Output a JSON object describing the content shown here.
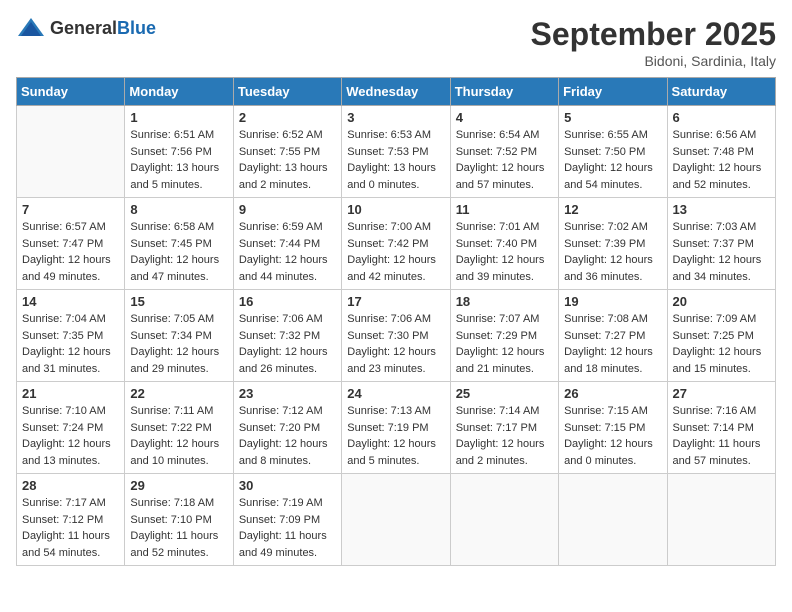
{
  "logo": {
    "general": "General",
    "blue": "Blue"
  },
  "title": "September 2025",
  "location": "Bidoni, Sardinia, Italy",
  "days_of_week": [
    "Sunday",
    "Monday",
    "Tuesday",
    "Wednesday",
    "Thursday",
    "Friday",
    "Saturday"
  ],
  "weeks": [
    [
      {
        "day": "",
        "sunrise": "",
        "sunset": "",
        "daylight": "",
        "empty": true
      },
      {
        "day": "1",
        "sunrise": "Sunrise: 6:51 AM",
        "sunset": "Sunset: 7:56 PM",
        "daylight": "Daylight: 13 hours and 5 minutes.",
        "empty": false
      },
      {
        "day": "2",
        "sunrise": "Sunrise: 6:52 AM",
        "sunset": "Sunset: 7:55 PM",
        "daylight": "Daylight: 13 hours and 2 minutes.",
        "empty": false
      },
      {
        "day": "3",
        "sunrise": "Sunrise: 6:53 AM",
        "sunset": "Sunset: 7:53 PM",
        "daylight": "Daylight: 13 hours and 0 minutes.",
        "empty": false
      },
      {
        "day": "4",
        "sunrise": "Sunrise: 6:54 AM",
        "sunset": "Sunset: 7:52 PM",
        "daylight": "Daylight: 12 hours and 57 minutes.",
        "empty": false
      },
      {
        "day": "5",
        "sunrise": "Sunrise: 6:55 AM",
        "sunset": "Sunset: 7:50 PM",
        "daylight": "Daylight: 12 hours and 54 minutes.",
        "empty": false
      },
      {
        "day": "6",
        "sunrise": "Sunrise: 6:56 AM",
        "sunset": "Sunset: 7:48 PM",
        "daylight": "Daylight: 12 hours and 52 minutes.",
        "empty": false
      }
    ],
    [
      {
        "day": "7",
        "sunrise": "Sunrise: 6:57 AM",
        "sunset": "Sunset: 7:47 PM",
        "daylight": "Daylight: 12 hours and 49 minutes.",
        "empty": false
      },
      {
        "day": "8",
        "sunrise": "Sunrise: 6:58 AM",
        "sunset": "Sunset: 7:45 PM",
        "daylight": "Daylight: 12 hours and 47 minutes.",
        "empty": false
      },
      {
        "day": "9",
        "sunrise": "Sunrise: 6:59 AM",
        "sunset": "Sunset: 7:44 PM",
        "daylight": "Daylight: 12 hours and 44 minutes.",
        "empty": false
      },
      {
        "day": "10",
        "sunrise": "Sunrise: 7:00 AM",
        "sunset": "Sunset: 7:42 PM",
        "daylight": "Daylight: 12 hours and 42 minutes.",
        "empty": false
      },
      {
        "day": "11",
        "sunrise": "Sunrise: 7:01 AM",
        "sunset": "Sunset: 7:40 PM",
        "daylight": "Daylight: 12 hours and 39 minutes.",
        "empty": false
      },
      {
        "day": "12",
        "sunrise": "Sunrise: 7:02 AM",
        "sunset": "Sunset: 7:39 PM",
        "daylight": "Daylight: 12 hours and 36 minutes.",
        "empty": false
      },
      {
        "day": "13",
        "sunrise": "Sunrise: 7:03 AM",
        "sunset": "Sunset: 7:37 PM",
        "daylight": "Daylight: 12 hours and 34 minutes.",
        "empty": false
      }
    ],
    [
      {
        "day": "14",
        "sunrise": "Sunrise: 7:04 AM",
        "sunset": "Sunset: 7:35 PM",
        "daylight": "Daylight: 12 hours and 31 minutes.",
        "empty": false
      },
      {
        "day": "15",
        "sunrise": "Sunrise: 7:05 AM",
        "sunset": "Sunset: 7:34 PM",
        "daylight": "Daylight: 12 hours and 29 minutes.",
        "empty": false
      },
      {
        "day": "16",
        "sunrise": "Sunrise: 7:06 AM",
        "sunset": "Sunset: 7:32 PM",
        "daylight": "Daylight: 12 hours and 26 minutes.",
        "empty": false
      },
      {
        "day": "17",
        "sunrise": "Sunrise: 7:06 AM",
        "sunset": "Sunset: 7:30 PM",
        "daylight": "Daylight: 12 hours and 23 minutes.",
        "empty": false
      },
      {
        "day": "18",
        "sunrise": "Sunrise: 7:07 AM",
        "sunset": "Sunset: 7:29 PM",
        "daylight": "Daylight: 12 hours and 21 minutes.",
        "empty": false
      },
      {
        "day": "19",
        "sunrise": "Sunrise: 7:08 AM",
        "sunset": "Sunset: 7:27 PM",
        "daylight": "Daylight: 12 hours and 18 minutes.",
        "empty": false
      },
      {
        "day": "20",
        "sunrise": "Sunrise: 7:09 AM",
        "sunset": "Sunset: 7:25 PM",
        "daylight": "Daylight: 12 hours and 15 minutes.",
        "empty": false
      }
    ],
    [
      {
        "day": "21",
        "sunrise": "Sunrise: 7:10 AM",
        "sunset": "Sunset: 7:24 PM",
        "daylight": "Daylight: 12 hours and 13 minutes.",
        "empty": false
      },
      {
        "day": "22",
        "sunrise": "Sunrise: 7:11 AM",
        "sunset": "Sunset: 7:22 PM",
        "daylight": "Daylight: 12 hours and 10 minutes.",
        "empty": false
      },
      {
        "day": "23",
        "sunrise": "Sunrise: 7:12 AM",
        "sunset": "Sunset: 7:20 PM",
        "daylight": "Daylight: 12 hours and 8 minutes.",
        "empty": false
      },
      {
        "day": "24",
        "sunrise": "Sunrise: 7:13 AM",
        "sunset": "Sunset: 7:19 PM",
        "daylight": "Daylight: 12 hours and 5 minutes.",
        "empty": false
      },
      {
        "day": "25",
        "sunrise": "Sunrise: 7:14 AM",
        "sunset": "Sunset: 7:17 PM",
        "daylight": "Daylight: 12 hours and 2 minutes.",
        "empty": false
      },
      {
        "day": "26",
        "sunrise": "Sunrise: 7:15 AM",
        "sunset": "Sunset: 7:15 PM",
        "daylight": "Daylight: 12 hours and 0 minutes.",
        "empty": false
      },
      {
        "day": "27",
        "sunrise": "Sunrise: 7:16 AM",
        "sunset": "Sunset: 7:14 PM",
        "daylight": "Daylight: 11 hours and 57 minutes.",
        "empty": false
      }
    ],
    [
      {
        "day": "28",
        "sunrise": "Sunrise: 7:17 AM",
        "sunset": "Sunset: 7:12 PM",
        "daylight": "Daylight: 11 hours and 54 minutes.",
        "empty": false
      },
      {
        "day": "29",
        "sunrise": "Sunrise: 7:18 AM",
        "sunset": "Sunset: 7:10 PM",
        "daylight": "Daylight: 11 hours and 52 minutes.",
        "empty": false
      },
      {
        "day": "30",
        "sunrise": "Sunrise: 7:19 AM",
        "sunset": "Sunset: 7:09 PM",
        "daylight": "Daylight: 11 hours and 49 minutes.",
        "empty": false
      },
      {
        "day": "",
        "sunrise": "",
        "sunset": "",
        "daylight": "",
        "empty": true
      },
      {
        "day": "",
        "sunrise": "",
        "sunset": "",
        "daylight": "",
        "empty": true
      },
      {
        "day": "",
        "sunrise": "",
        "sunset": "",
        "daylight": "",
        "empty": true
      },
      {
        "day": "",
        "sunrise": "",
        "sunset": "",
        "daylight": "",
        "empty": true
      }
    ]
  ]
}
